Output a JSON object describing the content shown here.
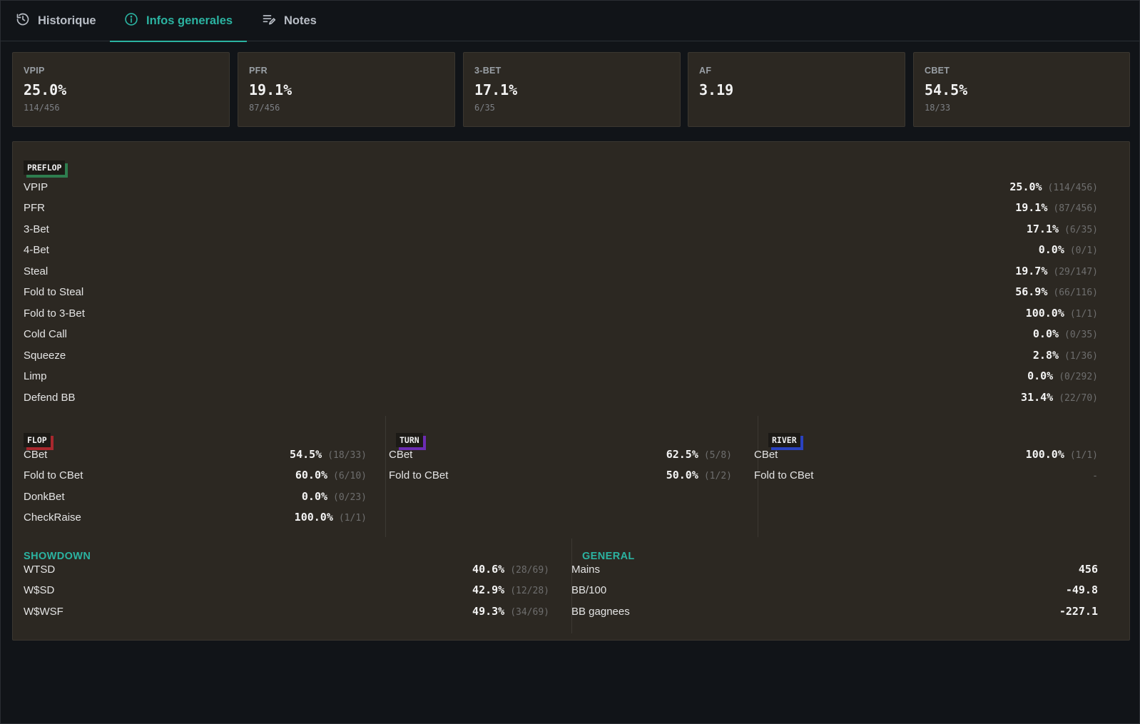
{
  "colors": {
    "accent": "#2bb3a1",
    "preflop_badge": "#2e7d4f",
    "flop_badge": "#a8282e",
    "turn_badge": "#6c2cb3",
    "river_badge": "#2a42c0"
  },
  "tabs": [
    {
      "label": "Historique",
      "icon": "history-icon"
    },
    {
      "label": "Infos generales",
      "icon": "info-icon",
      "active": true
    },
    {
      "label": "Notes",
      "icon": "notes-icon"
    }
  ],
  "cards": [
    {
      "label": "VPIP",
      "value": "25.0%",
      "sub": "114/456"
    },
    {
      "label": "PFR",
      "value": "19.1%",
      "sub": "87/456"
    },
    {
      "label": "3-BET",
      "value": "17.1%",
      "sub": "6/35"
    },
    {
      "label": "AF",
      "value": "3.19",
      "sub": ""
    },
    {
      "label": "CBET",
      "value": "54.5%",
      "sub": "18/33"
    }
  ],
  "preflop": {
    "badge": "PREFLOP",
    "rows": [
      {
        "name": "VPIP",
        "value": "25.0%",
        "frac": "(114/456)"
      },
      {
        "name": "PFR",
        "value": "19.1%",
        "frac": "(87/456)"
      },
      {
        "name": "3-Bet",
        "value": "17.1%",
        "frac": "(6/35)"
      },
      {
        "name": "4-Bet",
        "value": "0.0%",
        "frac": "(0/1)"
      },
      {
        "name": "Steal",
        "value": "19.7%",
        "frac": "(29/147)"
      },
      {
        "name": "Fold to Steal",
        "value": "56.9%",
        "frac": "(66/116)"
      },
      {
        "name": "Fold to 3-Bet",
        "value": "100.0%",
        "frac": "(1/1)"
      },
      {
        "name": "Cold Call",
        "value": "0.0%",
        "frac": "(0/35)"
      },
      {
        "name": "Squeeze",
        "value": "2.8%",
        "frac": "(1/36)"
      },
      {
        "name": "Limp",
        "value": "0.0%",
        "frac": "(0/292)"
      },
      {
        "name": "Defend BB",
        "value": "31.4%",
        "frac": "(22/70)"
      }
    ]
  },
  "flop": {
    "badge": "FLOP",
    "rows": [
      {
        "name": "CBet",
        "value": "54.5%",
        "frac": "(18/33)"
      },
      {
        "name": "Fold to CBet",
        "value": "60.0%",
        "frac": "(6/10)"
      },
      {
        "name": "DonkBet",
        "value": "0.0%",
        "frac": "(0/23)"
      },
      {
        "name": "CheckRaise",
        "value": "100.0%",
        "frac": "(1/1)"
      }
    ]
  },
  "turn": {
    "badge": "TURN",
    "rows": [
      {
        "name": "CBet",
        "value": "62.5%",
        "frac": "(5/8)"
      },
      {
        "name": "Fold to CBet",
        "value": "50.0%",
        "frac": "(1/2)"
      }
    ]
  },
  "river": {
    "badge": "RIVER",
    "rows": [
      {
        "name": "CBet",
        "value": "100.0%",
        "frac": "(1/1)"
      },
      {
        "name": "Fold to CBet",
        "value": "",
        "frac": "-"
      }
    ]
  },
  "showdown": {
    "title": "SHOWDOWN",
    "rows": [
      {
        "name": "WTSD",
        "value": "40.6%",
        "frac": "(28/69)"
      },
      {
        "name": "W$SD",
        "value": "42.9%",
        "frac": "(12/28)"
      },
      {
        "name": "W$WSF",
        "value": "49.3%",
        "frac": "(34/69)"
      }
    ]
  },
  "general": {
    "title": "GENERAL",
    "rows": [
      {
        "name": "Mains",
        "value": "456",
        "frac": ""
      },
      {
        "name": "BB/100",
        "value": "-49.8",
        "frac": ""
      },
      {
        "name": "BB gagnees",
        "value": "-227.1",
        "frac": ""
      }
    ]
  }
}
